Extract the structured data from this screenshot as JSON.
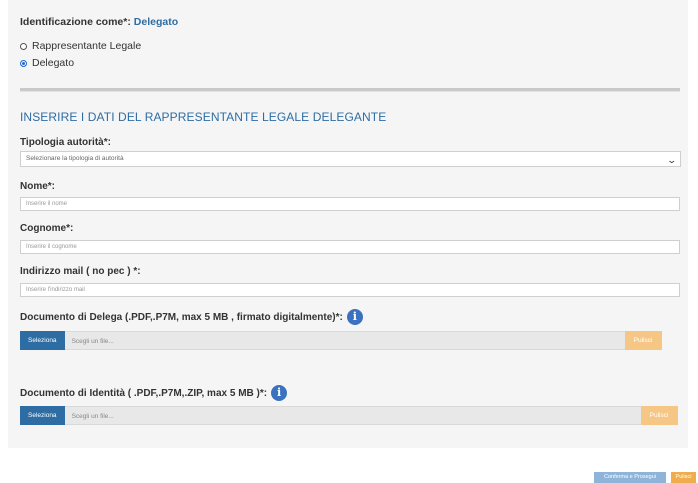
{
  "identification": {
    "label": "Identificazione come*:",
    "value": "Delegato",
    "options": [
      {
        "label": "Rappresentante Legale",
        "checked": false
      },
      {
        "label": "Delegato",
        "checked": true
      }
    ]
  },
  "section_title": "INSERIRE I DATI DEL RAPPRESENTANTE LEGALE DELEGANTE",
  "authority_type": {
    "label": "Tipologia autorità*:",
    "selected": "Selezionare la tipologia di autorità"
  },
  "nome": {
    "label": "Nome*:",
    "placeholder": "Inserire il nome"
  },
  "cognome": {
    "label": "Cognome*:",
    "placeholder": "Inserire il cognome"
  },
  "email": {
    "label": "Indirizzo mail ( no pec ) *:",
    "placeholder": "Inserire l'indirizzo mail"
  },
  "delega_doc": {
    "label": "Documento di Delega (.PDF,.P7M, max 5 MB , firmato digitalmente)*:",
    "select_label": "Seleziona",
    "file_placeholder": "Scegli un file...",
    "clear_label": "Pulisci"
  },
  "identity_doc": {
    "label": "Documento di Identità ( .PDF,.P7M,.ZIP, max 5 MB )*:",
    "select_label": "Seleziona",
    "file_placeholder": "Scegli un file...",
    "clear_label": "Pulisci"
  },
  "footer": {
    "confirm_label": "Conferma e Prosegui",
    "clear_label": "Pulisci"
  },
  "icons": {
    "info": "info-icon",
    "dropdown": "chevron-down-icon"
  },
  "colors": {
    "accent": "#2e6da4",
    "warning": "#f0ad4e",
    "panel_bg": "#f5f5f5"
  }
}
